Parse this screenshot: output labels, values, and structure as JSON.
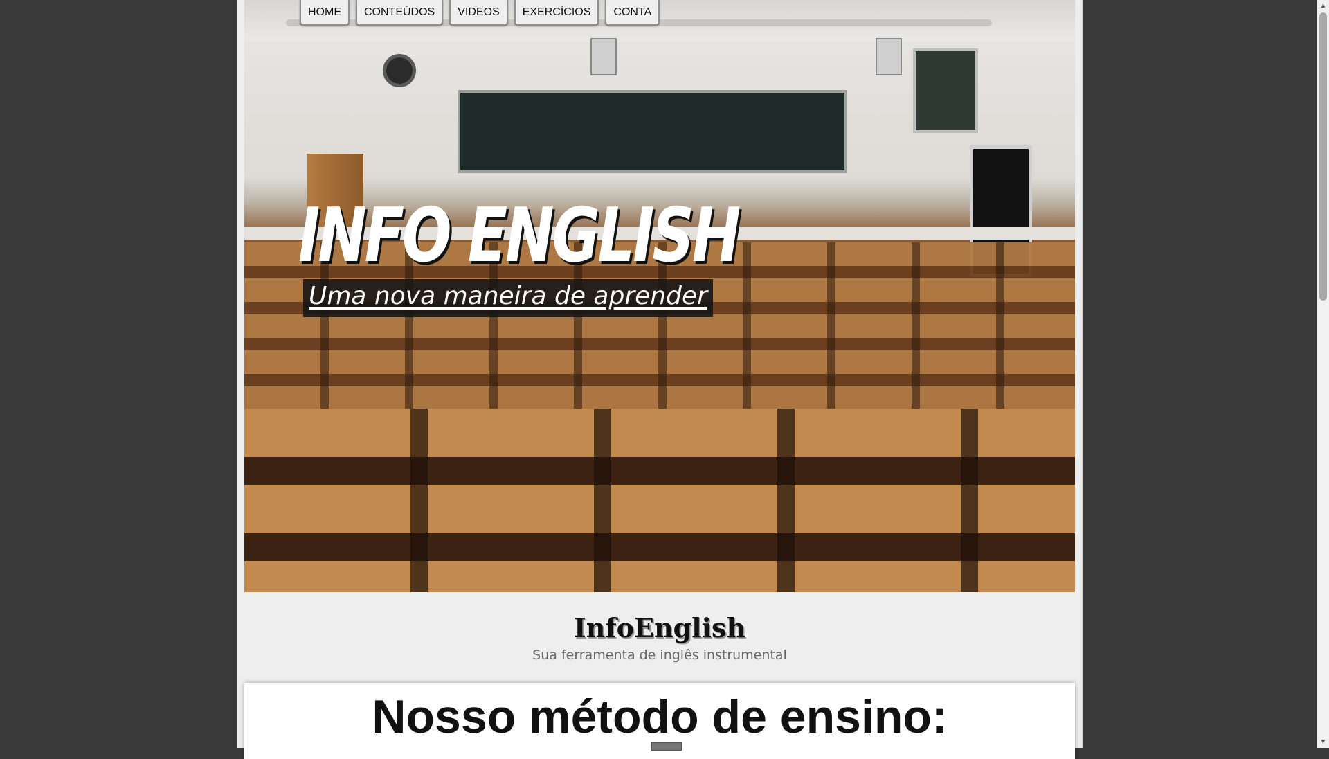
{
  "nav": {
    "items": [
      {
        "label": "HOME"
      },
      {
        "label": "CONTEÚDOS"
      },
      {
        "label": "VIDEOS"
      },
      {
        "label": "EXERCÍCIOS"
      },
      {
        "label": "CONTA"
      }
    ]
  },
  "hero": {
    "title": "INFO ENGLISH",
    "subtitle": "Uma nova maneira de aprender"
  },
  "brand": {
    "name": "InfoEnglish",
    "tagline": "Sua ferramenta de inglês instrumental"
  },
  "section": {
    "title": "Nosso método de ensino:"
  },
  "colors": {
    "page_background": "#3a3a3a",
    "content_background": "#eeeeee",
    "hero_text": "#ffffff"
  },
  "icons": {
    "scroll_up": "▲",
    "scroll_down": "▼"
  }
}
